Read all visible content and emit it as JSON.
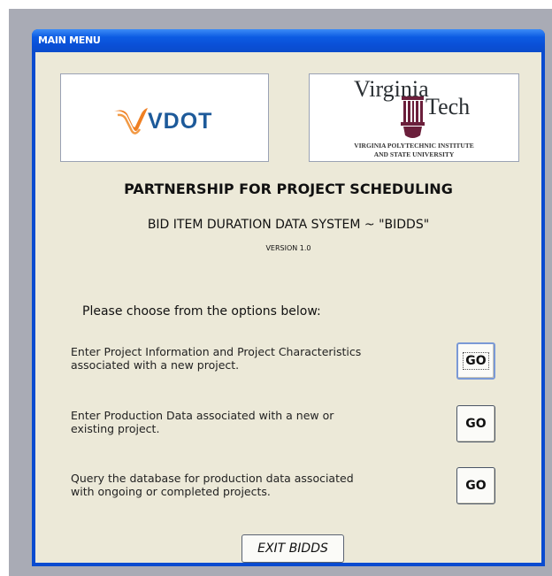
{
  "window": {
    "title": "MAIN MENU"
  },
  "logos": {
    "vdot": {
      "text": "VDOT",
      "accent_color": "#ef7f22",
      "text_color": "#1d5a9a"
    },
    "vt": {
      "word1": "Virginia",
      "word2": "Tech",
      "line1": "VIRGINIA POLYTECHNIC INSTITUTE",
      "line2": "AND STATE UNIVERSITY",
      "mark_color": "#6b1f3b"
    }
  },
  "main": {
    "heading": "PARTNERSHIP FOR PROJECT SCHEDULING",
    "subheading": "BID ITEM DURATION DATA SYSTEM ~ \"BIDDS\"",
    "version": "VERSION 1.0",
    "prompt": "Please choose from the options below:",
    "options": [
      {
        "line1": "Enter Project Information and Project Characteristics",
        "line2": "associated with a new project.",
        "button": "GO"
      },
      {
        "line1": "Enter Production Data associated with a new or",
        "line2": "existing project.",
        "button": "GO"
      },
      {
        "line1": "Query the database for production data associated",
        "line2": "with ongoing or completed projects.",
        "button": "GO"
      }
    ],
    "exit_label": "EXIT BIDDS"
  },
  "colors": {
    "titlebar": "#0a4bd0",
    "client_bg": "#ece9d8"
  }
}
